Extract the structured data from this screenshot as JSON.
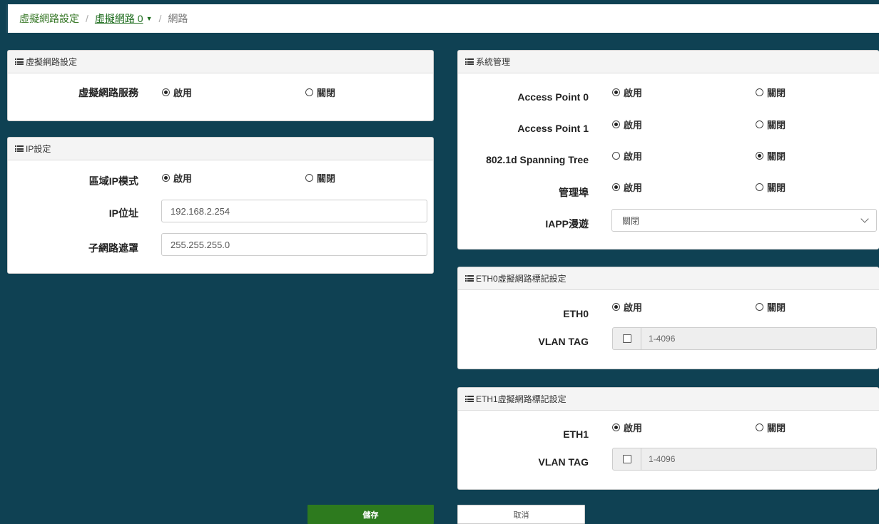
{
  "breadcrumb": {
    "level1": "虛擬網路設定",
    "level2": "虛擬網路 0",
    "level3": "網路"
  },
  "vnet_panel": {
    "title": "虛擬網路設定",
    "service_label": "虛擬網路服務",
    "enable": "啟用",
    "disable": "關閉",
    "selected": "enable"
  },
  "ip_panel": {
    "title": "IP設定",
    "mode_label": "區域IP模式",
    "enable": "啟用",
    "disable": "關閉",
    "ip_label": "IP位址",
    "ip_value": "192.168.2.254",
    "mask_label": "子網路遮罩",
    "mask_value": "255.255.255.0"
  },
  "sys_panel": {
    "title": "系統管理",
    "ap0_label": "Access Point 0",
    "ap1_label": "Access Point 1",
    "stp_label": "802.1d Spanning Tree",
    "mgmt_label": "管理埠",
    "iapp_label": "IAPP漫遊",
    "iapp_value": "關閉",
    "enable": "啟用",
    "disable": "關閉"
  },
  "eth0_panel": {
    "title": "ETH0虛擬網路標記設定",
    "eth_label": "ETH0",
    "vlan_label": "VLAN TAG",
    "vlan_placeholder": "1-4096",
    "enable": "啟用",
    "disable": "關閉"
  },
  "eth1_panel": {
    "title": "ETH1虛擬網路標記設定",
    "eth_label": "ETH1",
    "vlan_label": "VLAN TAG",
    "vlan_placeholder": "1-4096",
    "enable": "啟用",
    "disable": "關閉"
  },
  "buttons": {
    "save": "儲存",
    "cancel": "取消"
  },
  "icons": {
    "panel_header": "list-icon",
    "dropdown": "chevron-down-icon"
  }
}
